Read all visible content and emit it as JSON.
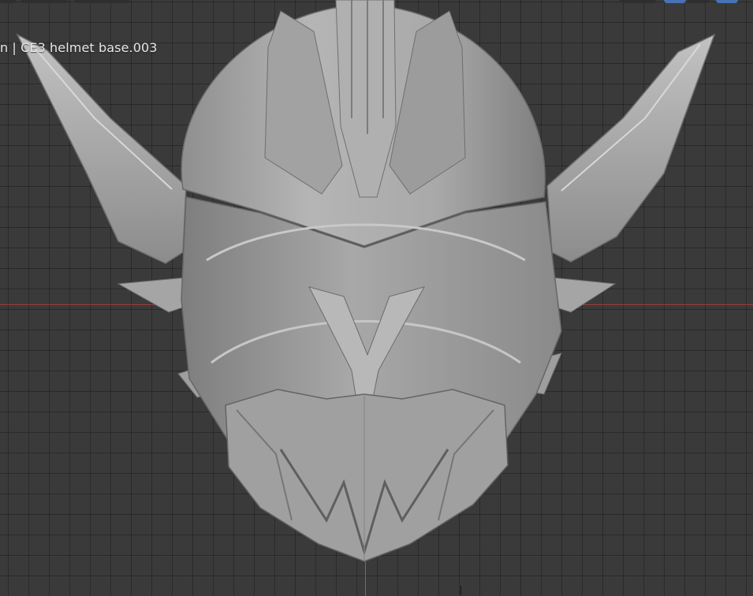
{
  "viewport": {
    "object_label": "n | CE3 helmet base.003"
  },
  "header": {
    "buttons": [
      "select-mode",
      "view-menu",
      "select-menu",
      "gizmo-toggle",
      "overlay-toggle",
      "overlay-dropdown",
      "shading-solid"
    ]
  },
  "colors": {
    "grid_bg": "#3a3a3a",
    "x_axis": "#9c3b3b",
    "y_axis": "#4873b8",
    "model_gray": "#a6a6a6",
    "accent_active": "#4772b3"
  }
}
